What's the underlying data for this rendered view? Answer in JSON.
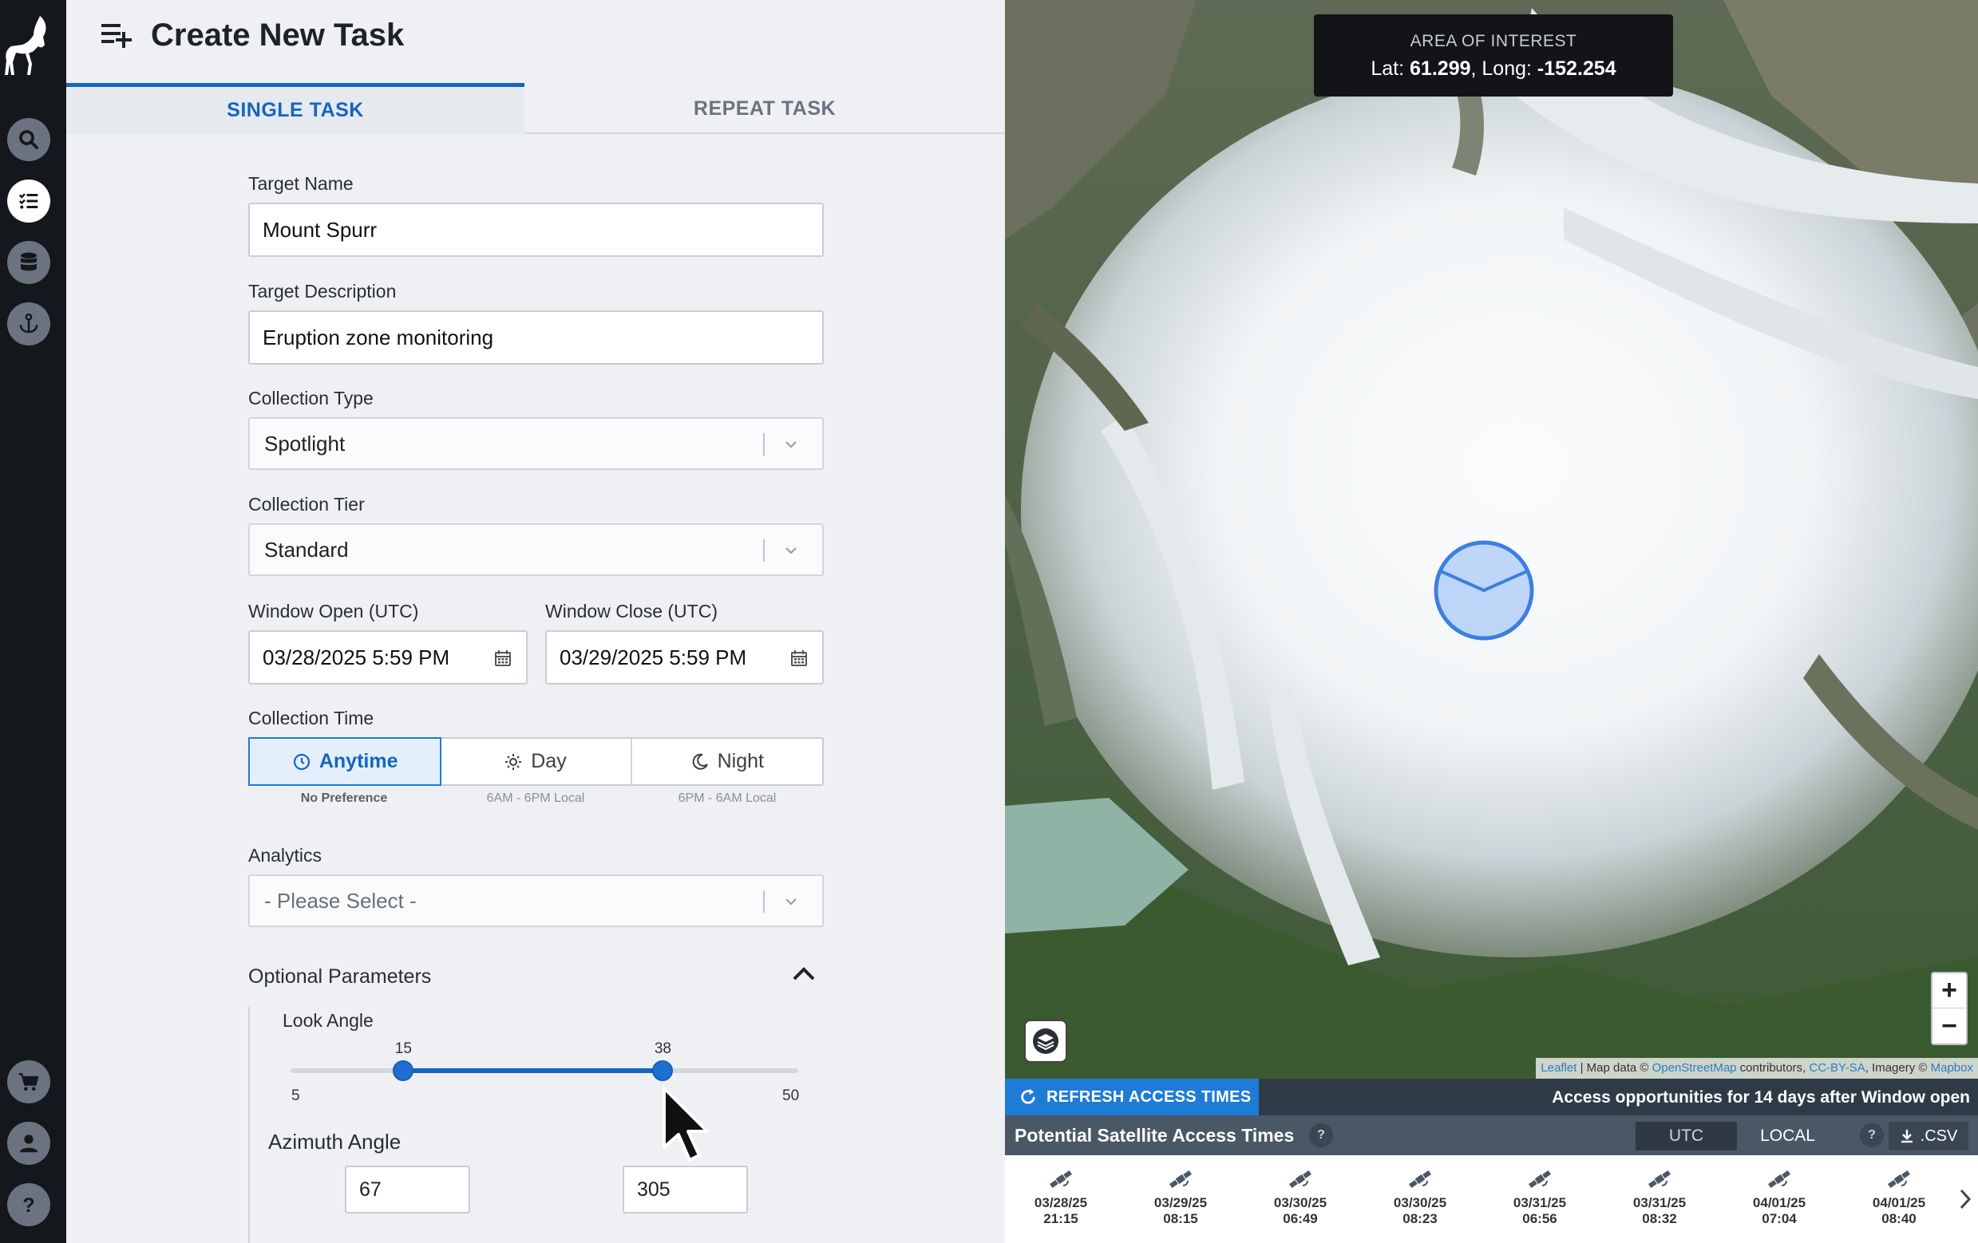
{
  "header": {
    "title": "Create New Task"
  },
  "tabs": [
    {
      "label": "SINGLE TASK",
      "active": true
    },
    {
      "label": "REPEAT TASK",
      "active": false
    }
  ],
  "form": {
    "target_name": {
      "label": "Target Name",
      "value": "Mount Spurr"
    },
    "target_description": {
      "label": "Target Description",
      "value": "Eruption zone monitoring"
    },
    "collection_type": {
      "label": "Collection Type",
      "value": "Spotlight"
    },
    "collection_tier": {
      "label": "Collection Tier",
      "value": "Standard"
    },
    "window_open": {
      "label": "Window Open (UTC)",
      "value": "03/28/2025 5:59 PM"
    },
    "window_close": {
      "label": "Window Close (UTC)",
      "value": "03/29/2025 5:59 PM"
    },
    "collection_time": {
      "label": "Collection Time",
      "options": [
        {
          "label": "Anytime",
          "sub": "No Preference",
          "icon": "clock-icon",
          "active": true
        },
        {
          "label": "Day",
          "sub": "6AM - 6PM Local",
          "icon": "sun-icon",
          "active": false
        },
        {
          "label": "Night",
          "sub": "6PM - 6AM Local",
          "icon": "moon-icon",
          "active": false
        }
      ]
    },
    "analytics": {
      "label": "Analytics",
      "placeholder": "- Please Select -"
    },
    "optional_parameters": {
      "title": "Optional Parameters",
      "look_angle": {
        "label": "Look Angle",
        "min": 5,
        "max": 50,
        "low": 15,
        "high": 38,
        "min_label": "5",
        "max_label": "50",
        "low_label": "15",
        "high_label": "38"
      },
      "azimuth_angle": {
        "label": "Azimuth Angle",
        "from": "67",
        "to": "305"
      }
    }
  },
  "map": {
    "aoi": {
      "title": "AREA OF INTEREST",
      "lat_label": "Lat: ",
      "lat": "61.299",
      "long_label": ", Long: ",
      "long": "-152.254"
    },
    "zoom_in": "+",
    "zoom_out": "−",
    "attribution": {
      "leaflet": "Leaflet",
      "sep1": " | Map data © ",
      "osm": "OpenStreetMap",
      "sep2": " contributors, ",
      "license": "CC-BY-SA",
      "sep3": ", Imagery © ",
      "mapbox": "Mapbox"
    }
  },
  "access": {
    "refresh_label": "REFRESH ACCESS TIMES",
    "note": "Access opportunities for 14 days after Window open",
    "title": "Potential Satellite Access Times",
    "help": "?",
    "tz_utc": "UTC",
    "tz_local": "LOCAL",
    "csv_label": ".CSV",
    "items": [
      {
        "date": "03/28/25",
        "time": "21:15"
      },
      {
        "date": "03/29/25",
        "time": "08:15"
      },
      {
        "date": "03/30/25",
        "time": "06:49"
      },
      {
        "date": "03/30/25",
        "time": "08:23"
      },
      {
        "date": "03/31/25",
        "time": "06:56"
      },
      {
        "date": "03/31/25",
        "time": "08:32"
      },
      {
        "date": "04/01/25",
        "time": "07:04"
      },
      {
        "date": "04/01/25",
        "time": "08:40"
      }
    ]
  },
  "colors": {
    "accent": "#1565c0",
    "rail": "#14171c",
    "panel": "#eef0f3"
  }
}
